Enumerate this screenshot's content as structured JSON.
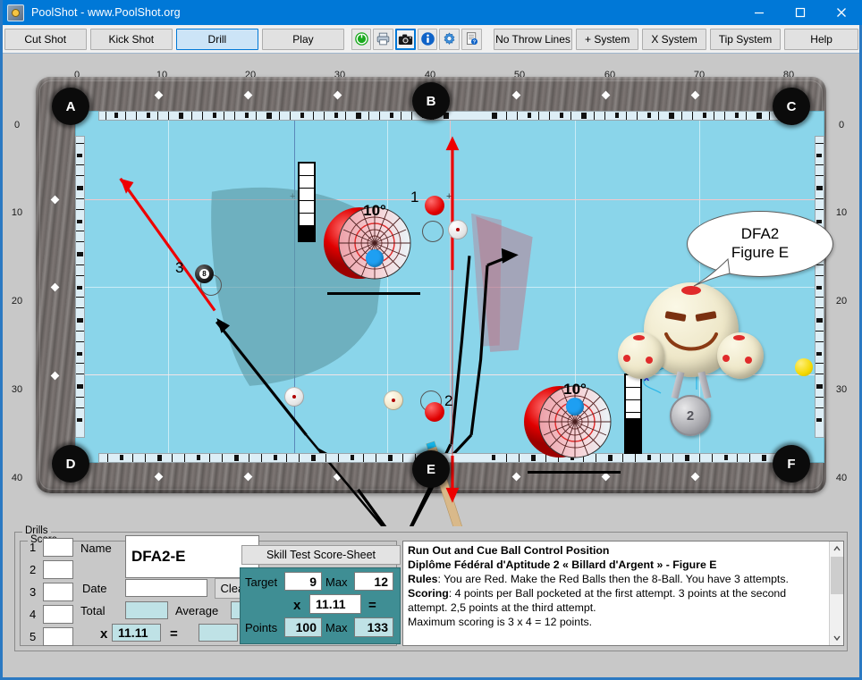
{
  "window": {
    "title": "PoolShot - www.PoolShot.org",
    "icon": "app-icon",
    "minimize": "—",
    "maximize": "□",
    "close": "✕"
  },
  "toolbar": {
    "modes": [
      {
        "label": "Cut Shot",
        "selected": false
      },
      {
        "label": "Kick Shot",
        "selected": false
      },
      {
        "label": "Drill",
        "selected": true
      },
      {
        "label": "Play",
        "selected": false
      }
    ],
    "icons": [
      {
        "name": "power-icon",
        "glyph": "⏻",
        "color": "#18a91c",
        "active": false
      },
      {
        "name": "printer-icon",
        "glyph": "⎙",
        "color": "#5b6b80",
        "active": false
      },
      {
        "name": "camera-icon",
        "glyph": "὏7",
        "color": "#1a1a1a",
        "active": true
      },
      {
        "name": "info-icon",
        "glyph": "i",
        "color": "#1060c8",
        "active": false
      },
      {
        "name": "gear-icon",
        "glyph": "⚙",
        "color": "#2a7fd0",
        "active": false
      },
      {
        "name": "help-document-icon",
        "glyph": "⍰",
        "color": "#555555",
        "active": false
      }
    ],
    "systems": [
      {
        "label": "No Throw Lines"
      },
      {
        "label": "+ System"
      },
      {
        "label": "X System"
      },
      {
        "label": "Tip System"
      }
    ],
    "help": "Help"
  },
  "table": {
    "top_ruler": [
      "0",
      "10",
      "20",
      "30",
      "40",
      "50",
      "60",
      "70",
      "80"
    ],
    "left_ruler": [
      "0",
      "10",
      "20",
      "30",
      "40"
    ],
    "right_ruler": [
      "0",
      "10",
      "20",
      "30",
      "40"
    ],
    "pockets": [
      "A",
      "B",
      "C",
      "D",
      "E",
      "F"
    ],
    "shot_numbers": [
      "1",
      "2",
      "3"
    ],
    "aimers": [
      {
        "name": "aim-target-top",
        "degrees": "10°",
        "tip_position": "below-center"
      },
      {
        "name": "aim-target-bottom",
        "degrees": "10°",
        "tip_position": "above-center"
      }
    ],
    "speech_bubble": {
      "line1": "DFA2",
      "line2": "Figure E"
    },
    "medal": "2",
    "cloth_color": "#8ad5ea",
    "rail_color": "#6f6a68",
    "aim_line_color": "#e00000"
  },
  "bottom": {
    "drills_caption": "Drills",
    "score_caption": "Score",
    "score_rows": [
      "1",
      "2",
      "3",
      "4",
      "5"
    ],
    "score_values": [
      "",
      "",
      "",
      "",
      ""
    ],
    "name_label": "Name",
    "name_value": "DFA2-E",
    "date_label": "Date",
    "date_value": "",
    "total_label": "Total",
    "total_value": "",
    "average_label": "Average",
    "average_value": "",
    "multiply_label": "x",
    "multiplier_value": "11.11",
    "equals_label": "=",
    "result_value": "",
    "clear_label": "Clear",
    "clear_icon": "undo-arrow-icon",
    "sheet_button": "Skill Test Score-Sheet",
    "target_label": "Target",
    "target_value": "9",
    "target_max_label": "Max",
    "target_max_value": "12",
    "teal_multiply_label": "x",
    "teal_multiplier_value": "11.11",
    "teal_equals_label": "=",
    "points_label": "Points",
    "points_value": "100",
    "points_max_label": "Max",
    "points_max_value": "133"
  },
  "description": {
    "title": "Run Out and Cue Ball Control Position",
    "subtitle": "Diplôme Fédéral d'Aptitude 2 « Billard d'Argent » - Figure E",
    "rules_label": "Rules",
    "rules_text": ": You are Red. Make the Red Balls then the 8-Ball. You have 3 attempts.",
    "scoring_label": "Scoring",
    "scoring_text": ": 4 points per Ball pocketed at the first attempt. 3 points at the second attempt. 2,5 points at the third attempt.",
    "max_text": "Maximum scoring is 3 x 4 = 12 points.",
    "scroll_up": "⌃",
    "scroll_down": "⌄"
  }
}
